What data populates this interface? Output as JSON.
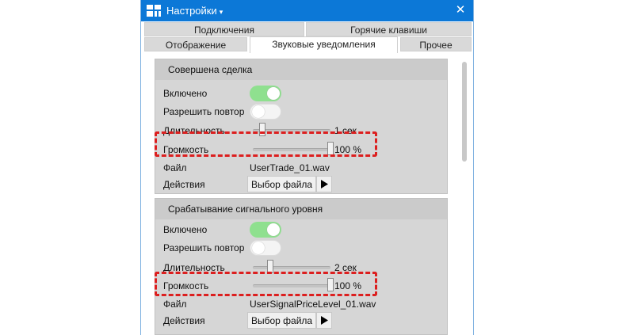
{
  "window": {
    "title": "Настройки",
    "title_caret": "▾",
    "close_glyph": "✕"
  },
  "tabs": {
    "row1": [
      "Подключения",
      "Горячие клавиши"
    ],
    "row2": [
      "Отображение",
      "Звуковые уведомления",
      "Прочее"
    ],
    "active": "Звуковые уведомления"
  },
  "panels": [
    {
      "title": "Совершена сделка",
      "enabled_label": "Включено",
      "enabled": true,
      "repeat_label": "Разрешить повтор",
      "repeat": false,
      "duration_label": "Длительность",
      "duration_value": "1 сек",
      "duration_fraction": 0.12,
      "volume_label": "Громкость",
      "volume_value": "100 %",
      "volume_fraction": 1.0,
      "file_label": "Файл",
      "file_name": "UserTrade_01.wav",
      "actions_label": "Действия",
      "choose_file_label": "Выбор файла"
    },
    {
      "title": "Срабатывание сигнального уровня",
      "enabled_label": "Включено",
      "enabled": true,
      "repeat_label": "Разрешить повтор",
      "repeat": false,
      "duration_label": "Длительность",
      "duration_value": "2 сек",
      "duration_fraction": 0.22,
      "volume_label": "Громкость",
      "volume_value": "100 %",
      "volume_fraction": 1.0,
      "file_label": "Файл",
      "file_name": "UserSignalPriceLevel_01.wav",
      "actions_label": "Действия",
      "choose_file_label": "Выбор файла"
    }
  ],
  "colors": {
    "titlebar": "#0c78d7",
    "toggle_on": "#8fe08f",
    "highlight": "#dc1f1f"
  },
  "icons": {
    "app": "app-logo-icon",
    "close": "close-icon",
    "play": "play-icon"
  }
}
